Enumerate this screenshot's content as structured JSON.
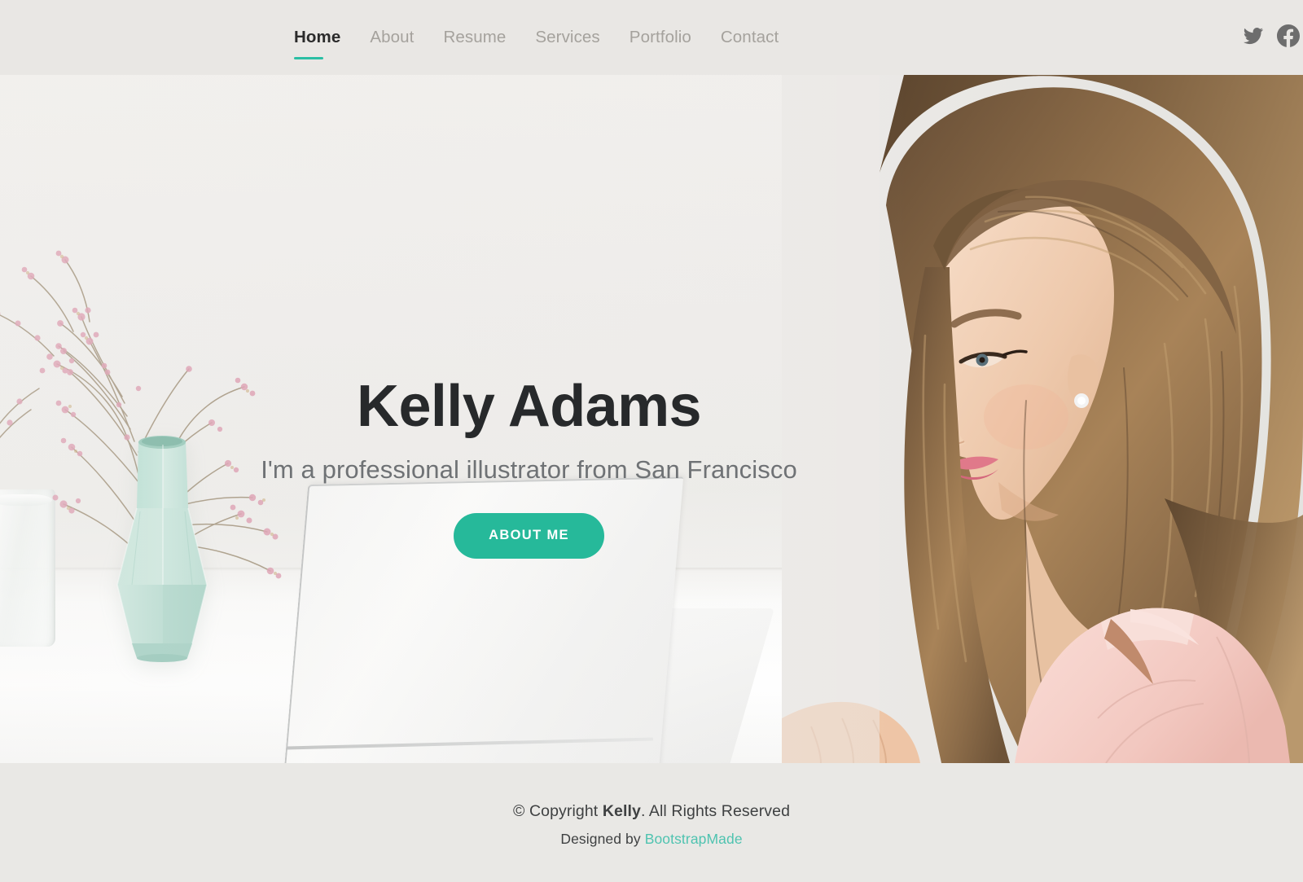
{
  "header": {
    "nav": [
      {
        "label": "Home",
        "active": true
      },
      {
        "label": "About",
        "active": false
      },
      {
        "label": "Resume",
        "active": false
      },
      {
        "label": "Services",
        "active": false
      },
      {
        "label": "Portfolio",
        "active": false
      },
      {
        "label": "Contact",
        "active": false
      }
    ],
    "social": [
      {
        "name": "twitter-icon",
        "label": "Twitter"
      },
      {
        "name": "facebook-icon",
        "label": "Facebook"
      }
    ],
    "background_color": "#e9e7e4",
    "active_underline_color": "#2bbfa4"
  },
  "hero": {
    "title": "Kelly Adams",
    "subtitle": "I'm a professional illustrator from San Francisco",
    "cta_label": "ABOUT ME",
    "cta_color": "#26b99a",
    "photo_description": "Woman in pink blazer working at a laptop beside a mint vase with dried pink flowers"
  },
  "footer": {
    "copyright_prefix": "© Copyright ",
    "copyright_name": "Kelly",
    "copyright_suffix": ". All Rights Reserved",
    "credits_prefix": "Designed by ",
    "credits_link": "BootstrapMade",
    "link_color": "#4fc3b0",
    "background_color": "#e9e8e5"
  }
}
